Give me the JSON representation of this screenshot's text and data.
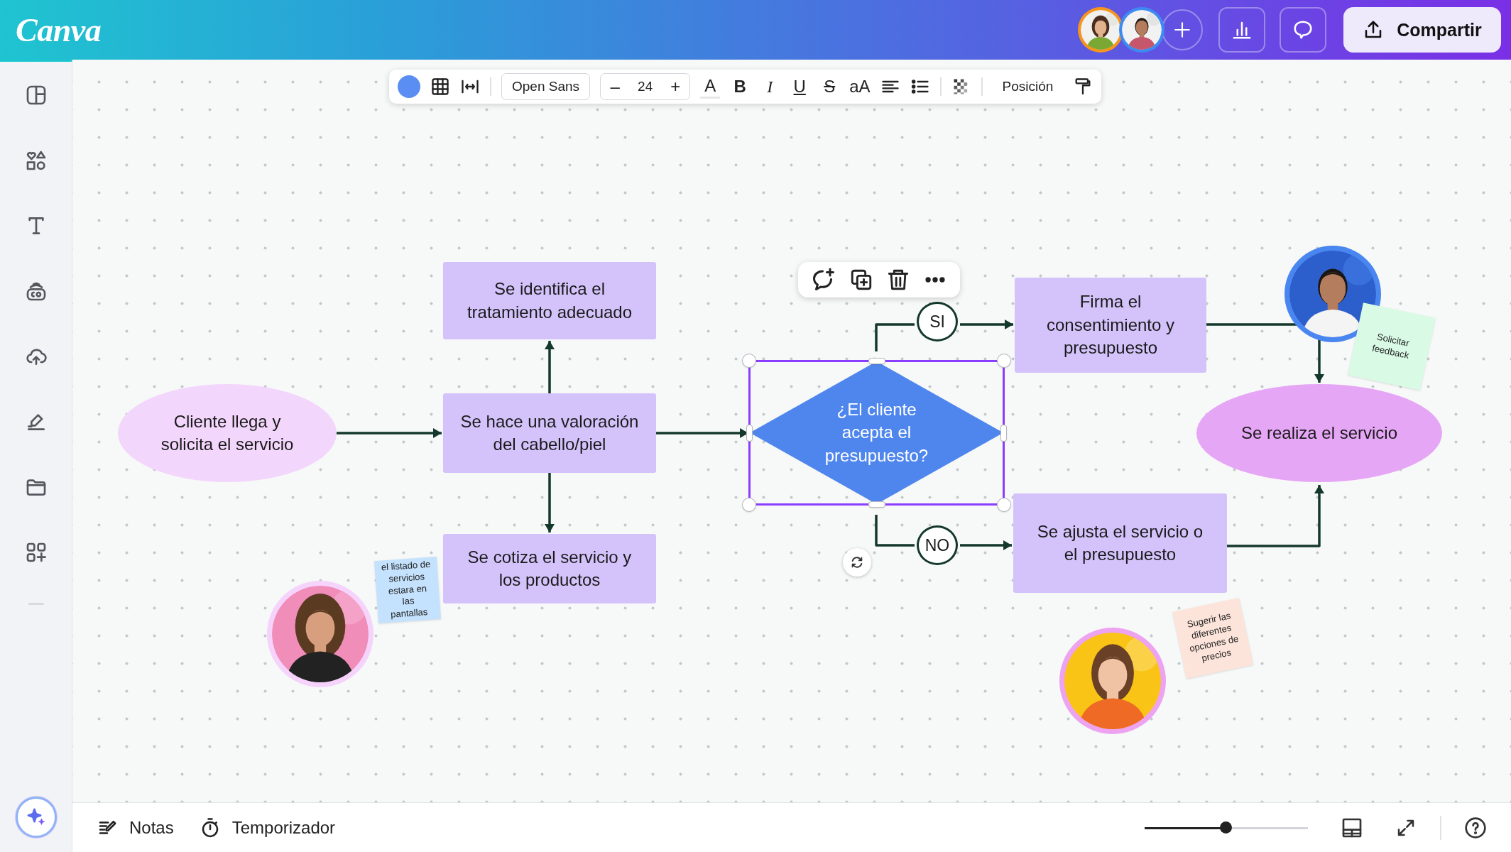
{
  "top_bar": {
    "logo": "Canva",
    "collaborators": [
      {
        "color": "#f7941d"
      },
      {
        "color": "#3d8bf2"
      }
    ],
    "share_button": "Compartir"
  },
  "format_toolbar": {
    "color": "#5a8ef2",
    "font": "Open Sans",
    "size_minus": "–",
    "size": "24",
    "size_plus": "+",
    "text_color": "A",
    "bold": "B",
    "italic": "I",
    "underline": "U",
    "strikethrough": "S",
    "case": "aA",
    "position": "Posición"
  },
  "nodes": [
    {
      "kind": "oval",
      "text": "Cliente llega y solicita el servicio",
      "color": "#f3d6fb",
      "selected": false
    },
    {
      "kind": "box",
      "text": "Se identifica el tratamiento adecuado",
      "color": "#d4c3fb",
      "selected": false
    },
    {
      "kind": "box",
      "text": "Se hace una valoración del cabello/piel",
      "color": "#d4c3fb",
      "selected": false
    },
    {
      "kind": "box",
      "text": "Se cotiza el servicio y los productos",
      "color": "#d4c3fb",
      "selected": false
    },
    {
      "kind": "diamond",
      "text": "¿El cliente acepta el presupuesto?",
      "color": "#4f86ee",
      "selected": true
    },
    {
      "kind": "box",
      "text": "Firma el consentimiento y presupuesto",
      "color": "#d4c3fb",
      "selected": false
    },
    {
      "kind": "box",
      "text": "Se ajusta el servicio o el presupuesto",
      "color": "#d4c3fb",
      "selected": false
    },
    {
      "kind": "oval",
      "text": "Se realiza el servicio",
      "color": "#e6a6f6",
      "selected": false
    }
  ],
  "branch_labels": [
    "SI",
    "NO"
  ],
  "photos": [
    {
      "kind": "picture",
      "color": "#f5d3fb"
    },
    {
      "kind": "picture",
      "color": "#4a86f0"
    },
    {
      "kind": "picture",
      "color": "#eda3f0"
    }
  ],
  "sticky_notes": [
    {
      "text": "el listado de servicios estara en las pantallas",
      "color": "#c4e2fd"
    },
    {
      "text": "Solicitar feedback",
      "color": "#d9fbe6"
    },
    {
      "text": "Sugerir las diferentes opciones de precios",
      "color": "#fde4da"
    }
  ],
  "bottom_bar": {
    "notes": "Notas",
    "timer": "Temporizador",
    "zoom": {
      "level": 0.5
    }
  }
}
